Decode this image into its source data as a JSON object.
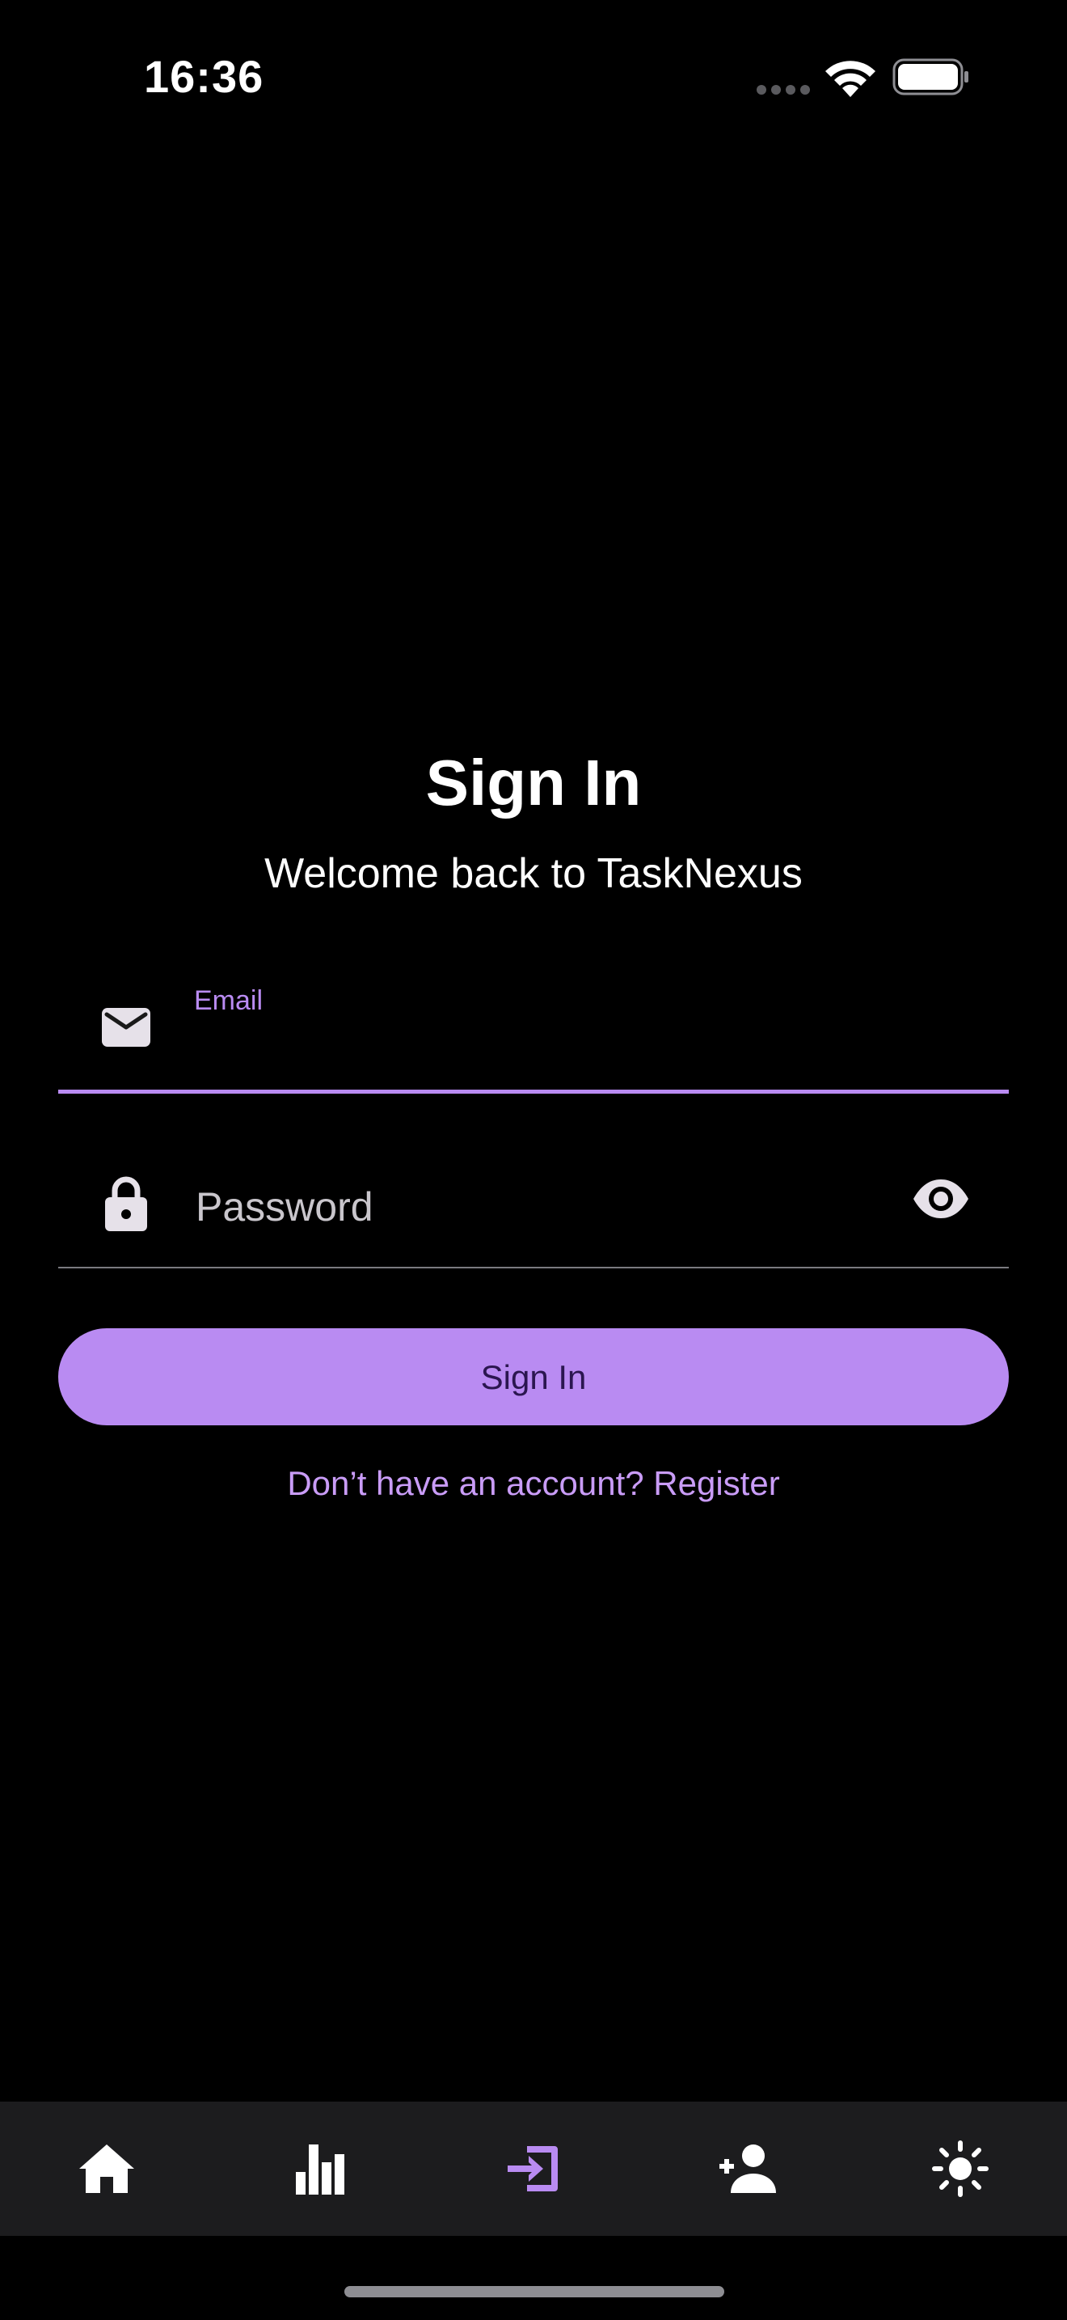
{
  "status_bar": {
    "time": "16:36"
  },
  "header": {
    "title": "Sign In",
    "subtitle": "Welcome back to TaskNexus"
  },
  "form": {
    "email_label": "Email",
    "email_value": "",
    "password_placeholder": "Password",
    "password_value": "",
    "submit_label": "Sign In",
    "register_link": "Don’t have an account? Register"
  },
  "bottom_nav": {
    "items": [
      {
        "icon": "home-icon",
        "active": false
      },
      {
        "icon": "bar-chart-icon",
        "active": false
      },
      {
        "icon": "login-icon",
        "active": true
      },
      {
        "icon": "add-person-icon",
        "active": false
      },
      {
        "icon": "brightness-icon",
        "active": false
      }
    ]
  },
  "colors": {
    "background": "#000000",
    "accent": "#b98bf2",
    "accent_text": "#c99cf7",
    "button_text": "#2b1650",
    "nav_background": "#1c1c1e",
    "icon_default": "#ffffff"
  }
}
